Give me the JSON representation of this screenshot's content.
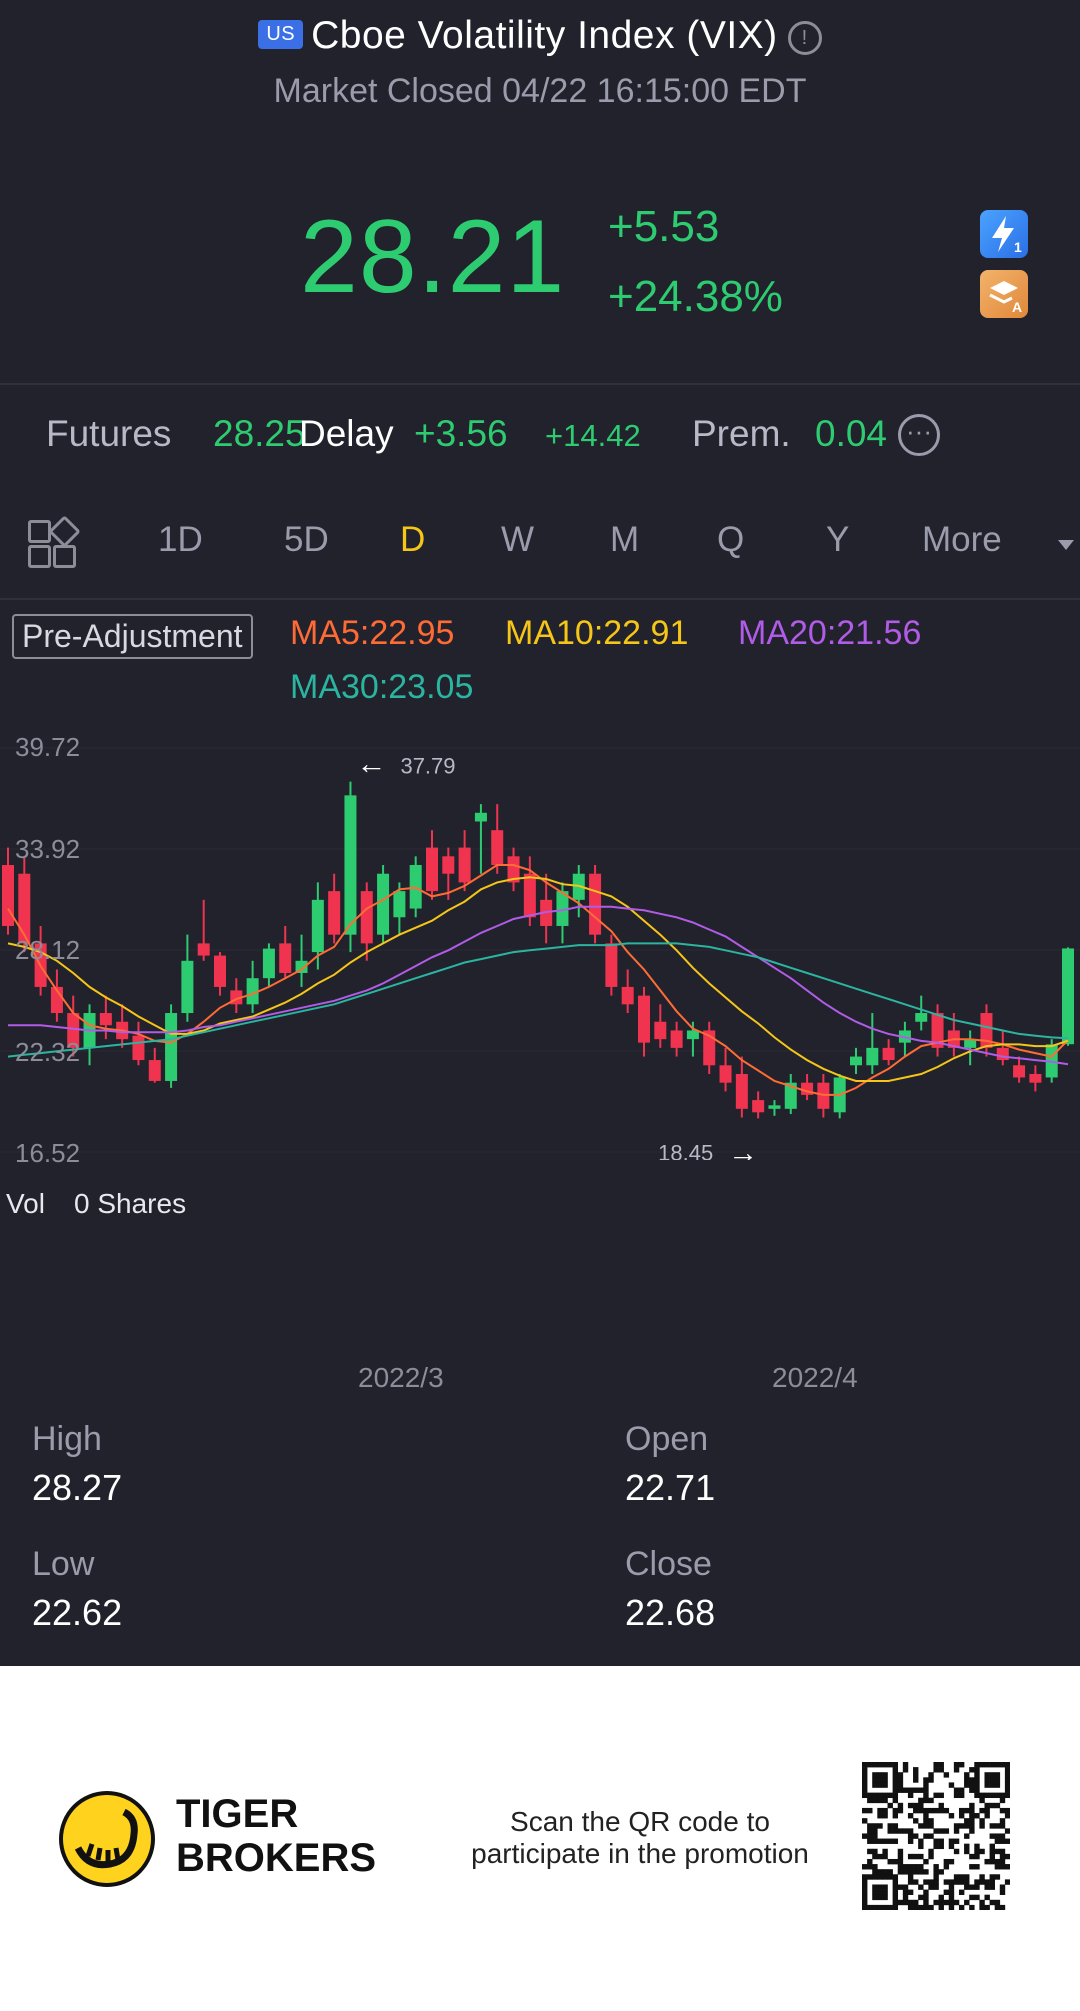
{
  "header": {
    "market_badge": "US",
    "title": "Cboe Volatility Index (VIX)",
    "status": "Market Closed 04/22 16:15:00 EDT"
  },
  "quote": {
    "price": "28.21",
    "change": "+5.53",
    "change_pct": "+24.38%",
    "side_icon_1": "lightning-icon",
    "side_icon_2": "stack-icon"
  },
  "futures": {
    "label": "Futures",
    "price": "28.25",
    "delay": "Delay",
    "change": "+3.56",
    "change2": "+14.42",
    "prem_label": "Prem.",
    "prem_value": "0.04"
  },
  "tabs": [
    "1D",
    "5D",
    "D",
    "W",
    "M",
    "Q",
    "Y",
    "More"
  ],
  "active_tab": "D",
  "indicators": {
    "adjustment": "Pre-Adjustment",
    "ma5": "MA5:22.95",
    "ma10": "MA10:22.91",
    "ma20": "MA20:21.56",
    "ma30": "MA30:23.05"
  },
  "chart_data": {
    "type": "candlestick",
    "y_ticks": [
      "39.72",
      "33.92",
      "28.12",
      "22.32",
      "16.52"
    ],
    "ylim": [
      16.52,
      39.72
    ],
    "x_ticks": [
      "2022/3",
      "2022/4"
    ],
    "high_marker": "37.79",
    "low_marker": "18.45",
    "candles": [
      {
        "o": 33.0,
        "h": 34.0,
        "l": 29.0,
        "c": 29.5
      },
      {
        "o": 32.5,
        "h": 33.5,
        "l": 28.0,
        "c": 28.5
      },
      {
        "o": 28.5,
        "h": 29.5,
        "l": 25.5,
        "c": 26.0
      },
      {
        "o": 26.0,
        "h": 27.0,
        "l": 24.0,
        "c": 24.5
      },
      {
        "o": 24.5,
        "h": 25.5,
        "l": 22.0,
        "c": 22.5
      },
      {
        "o": 22.5,
        "h": 25.0,
        "l": 21.5,
        "c": 24.5
      },
      {
        "o": 24.5,
        "h": 25.5,
        "l": 23.0,
        "c": 23.8
      },
      {
        "o": 24.0,
        "h": 25.0,
        "l": 22.5,
        "c": 23.0
      },
      {
        "o": 23.2,
        "h": 24.0,
        "l": 21.5,
        "c": 21.8
      },
      {
        "o": 21.8,
        "h": 22.5,
        "l": 20.5,
        "c": 20.6
      },
      {
        "o": 20.6,
        "h": 25.0,
        "l": 20.2,
        "c": 24.5
      },
      {
        "o": 24.5,
        "h": 29.0,
        "l": 24.0,
        "c": 27.5
      },
      {
        "o": 28.5,
        "h": 31.0,
        "l": 27.5,
        "c": 27.8
      },
      {
        "o": 27.8,
        "h": 28.0,
        "l": 25.5,
        "c": 26.0
      },
      {
        "o": 25.8,
        "h": 26.5,
        "l": 24.5,
        "c": 25.0
      },
      {
        "o": 25.0,
        "h": 27.5,
        "l": 24.5,
        "c": 26.5
      },
      {
        "o": 26.5,
        "h": 28.5,
        "l": 26.0,
        "c": 28.2
      },
      {
        "o": 28.5,
        "h": 29.5,
        "l": 26.5,
        "c": 26.8
      },
      {
        "o": 26.8,
        "h": 29.0,
        "l": 26.0,
        "c": 27.5
      },
      {
        "o": 28.0,
        "h": 32.0,
        "l": 27.0,
        "c": 31.0
      },
      {
        "o": 31.5,
        "h": 32.5,
        "l": 28.5,
        "c": 29.0
      },
      {
        "o": 29.0,
        "h": 37.79,
        "l": 28.0,
        "c": 37.0
      },
      {
        "o": 31.5,
        "h": 32.0,
        "l": 27.5,
        "c": 28.5
      },
      {
        "o": 29.0,
        "h": 33.0,
        "l": 28.5,
        "c": 32.5
      },
      {
        "o": 30.0,
        "h": 32.0,
        "l": 29.0,
        "c": 31.5
      },
      {
        "o": 30.5,
        "h": 33.5,
        "l": 30.0,
        "c": 33.0
      },
      {
        "o": 34.0,
        "h": 35.0,
        "l": 31.0,
        "c": 31.5
      },
      {
        "o": 33.5,
        "h": 34.0,
        "l": 31.0,
        "c": 32.5
      },
      {
        "o": 34.0,
        "h": 35.0,
        "l": 31.5,
        "c": 32.0
      },
      {
        "o": 35.5,
        "h": 36.5,
        "l": 32.5,
        "c": 36.0
      },
      {
        "o": 35.0,
        "h": 36.5,
        "l": 32.5,
        "c": 33.0
      },
      {
        "o": 33.5,
        "h": 34.0,
        "l": 31.5,
        "c": 32.0
      },
      {
        "o": 32.5,
        "h": 33.5,
        "l": 29.5,
        "c": 30.0
      },
      {
        "o": 31.0,
        "h": 32.5,
        "l": 28.5,
        "c": 29.5
      },
      {
        "o": 29.5,
        "h": 32.0,
        "l": 28.5,
        "c": 31.5
      },
      {
        "o": 31.0,
        "h": 33.0,
        "l": 30.0,
        "c": 32.5
      },
      {
        "o": 32.5,
        "h": 33.0,
        "l": 28.5,
        "c": 29.0
      },
      {
        "o": 28.5,
        "h": 29.0,
        "l": 25.5,
        "c": 26.0
      },
      {
        "o": 26.0,
        "h": 27.0,
        "l": 24.5,
        "c": 25.0
      },
      {
        "o": 25.5,
        "h": 26.0,
        "l": 22.0,
        "c": 22.8
      },
      {
        "o": 24.0,
        "h": 25.0,
        "l": 22.5,
        "c": 23.0
      },
      {
        "o": 23.5,
        "h": 24.0,
        "l": 22.0,
        "c": 22.5
      },
      {
        "o": 23.0,
        "h": 24.0,
        "l": 22.0,
        "c": 23.5
      },
      {
        "o": 23.5,
        "h": 24.0,
        "l": 21.0,
        "c": 21.5
      },
      {
        "o": 21.5,
        "h": 22.5,
        "l": 20.0,
        "c": 20.5
      },
      {
        "o": 21.0,
        "h": 22.0,
        "l": 18.5,
        "c": 19.0
      },
      {
        "o": 19.5,
        "h": 20.0,
        "l": 18.45,
        "c": 18.8
      },
      {
        "o": 19.0,
        "h": 19.5,
        "l": 18.6,
        "c": 19.2
      },
      {
        "o": 19.0,
        "h": 21.0,
        "l": 18.7,
        "c": 20.5
      },
      {
        "o": 20.5,
        "h": 21.0,
        "l": 19.5,
        "c": 19.8
      },
      {
        "o": 20.5,
        "h": 21.0,
        "l": 18.5,
        "c": 19.0
      },
      {
        "o": 18.8,
        "h": 21.0,
        "l": 18.45,
        "c": 20.8
      },
      {
        "o": 21.5,
        "h": 22.5,
        "l": 21.0,
        "c": 22.0
      },
      {
        "o": 21.5,
        "h": 24.5,
        "l": 21.0,
        "c": 22.5
      },
      {
        "o": 22.5,
        "h": 23.0,
        "l": 21.5,
        "c": 21.8
      },
      {
        "o": 22.8,
        "h": 24.0,
        "l": 22.0,
        "c": 23.5
      },
      {
        "o": 24.0,
        "h": 25.5,
        "l": 23.5,
        "c": 24.5
      },
      {
        "o": 24.5,
        "h": 25.0,
        "l": 22.0,
        "c": 22.5
      },
      {
        "o": 23.5,
        "h": 24.5,
        "l": 22.0,
        "c": 22.5
      },
      {
        "o": 22.5,
        "h": 23.5,
        "l": 21.5,
        "c": 23.0
      },
      {
        "o": 24.5,
        "h": 25.0,
        "l": 22.0,
        "c": 22.5
      },
      {
        "o": 22.5,
        "h": 23.5,
        "l": 21.5,
        "c": 21.8
      },
      {
        "o": 21.5,
        "h": 22.0,
        "l": 20.5,
        "c": 20.8
      },
      {
        "o": 21.0,
        "h": 21.5,
        "l": 20.0,
        "c": 20.5
      },
      {
        "o": 20.8,
        "h": 23.0,
        "l": 20.5,
        "c": 22.7
      },
      {
        "o": 22.71,
        "h": 28.27,
        "l": 22.62,
        "c": 28.21
      }
    ],
    "series": [
      {
        "name": "MA5",
        "color": "#ff6b35",
        "values": [
          30.5,
          29.0,
          27.2,
          25.8,
          24.5,
          23.8,
          23.6,
          23.5,
          23.3,
          22.9,
          22.8,
          23.3,
          24.0,
          24.8,
          25.3,
          25.6,
          26.0,
          26.5,
          27.0,
          27.8,
          28.3,
          29.6,
          30.5,
          31.0,
          31.6,
          31.7,
          31.2,
          31.4,
          31.8,
          32.4,
          33.0,
          33.0,
          32.7,
          32.0,
          31.4,
          30.8,
          30.0,
          29.2,
          28.0,
          27.0,
          25.8,
          24.6,
          23.6,
          23.2,
          22.6,
          21.8,
          21.2,
          20.6,
          20.3,
          20.0,
          19.8,
          19.8,
          20.2,
          20.8,
          21.3,
          22.0,
          22.6,
          22.8,
          23.0,
          23.0,
          22.9,
          22.7,
          22.4,
          22.2,
          22.0,
          22.95
        ]
      },
      {
        "name": "MA10",
        "color": "#f5c518",
        "values": [
          28.5,
          28.3,
          28.0,
          27.5,
          26.8,
          26.0,
          25.4,
          24.9,
          24.3,
          23.8,
          23.3,
          23.3,
          23.5,
          23.9,
          24.1,
          24.3,
          24.7,
          25.1,
          25.6,
          26.2,
          26.7,
          27.4,
          28.0,
          28.5,
          29.0,
          29.4,
          29.8,
          30.4,
          30.9,
          31.6,
          32.0,
          32.2,
          32.3,
          32.2,
          31.9,
          31.8,
          31.5,
          31.2,
          30.6,
          29.8,
          29.0,
          28.1,
          27.1,
          26.2,
          25.4,
          24.6,
          23.9,
          23.1,
          22.4,
          21.8,
          21.3,
          20.9,
          20.6,
          20.6,
          20.6,
          20.8,
          21.0,
          21.4,
          21.9,
          22.3,
          22.6,
          22.7,
          22.7,
          22.6,
          22.6,
          22.91
        ]
      },
      {
        "name": "MA20",
        "color": "#b05ce6",
        "values": [
          23.8,
          23.8,
          23.8,
          23.7,
          23.6,
          23.5,
          23.5,
          23.4,
          23.4,
          23.4,
          23.4,
          23.5,
          23.7,
          23.8,
          24.0,
          24.2,
          24.4,
          24.6,
          24.8,
          25.0,
          25.2,
          25.5,
          25.8,
          26.2,
          26.7,
          27.2,
          27.7,
          28.1,
          28.6,
          29.1,
          29.5,
          29.9,
          30.1,
          30.3,
          30.4,
          30.6,
          30.6,
          30.6,
          30.5,
          30.4,
          30.2,
          30.0,
          29.7,
          29.3,
          28.9,
          28.3,
          27.7,
          27.1,
          26.5,
          25.8,
          25.1,
          24.5,
          24.0,
          23.6,
          23.3,
          23.1,
          22.9,
          22.8,
          22.6,
          22.4,
          22.2,
          22.0,
          21.9,
          21.8,
          21.7,
          21.56
        ]
      },
      {
        "name": "MA30",
        "color": "#2bb5a0",
        "values": [
          22.0,
          22.1,
          22.2,
          22.3,
          22.4,
          22.5,
          22.6,
          22.7,
          22.8,
          22.9,
          23.0,
          23.2,
          23.4,
          23.6,
          23.8,
          24.0,
          24.2,
          24.4,
          24.6,
          24.8,
          25.0,
          25.3,
          25.6,
          25.9,
          26.2,
          26.5,
          26.8,
          27.1,
          27.4,
          27.6,
          27.8,
          28.0,
          28.1,
          28.2,
          28.3,
          28.4,
          28.4,
          28.4,
          28.5,
          28.5,
          28.5,
          28.5,
          28.4,
          28.3,
          28.1,
          27.9,
          27.7,
          27.4,
          27.1,
          26.8,
          26.5,
          26.2,
          25.9,
          25.6,
          25.3,
          25.0,
          24.7,
          24.4,
          24.1,
          23.9,
          23.7,
          23.5,
          23.3,
          23.2,
          23.1,
          23.05
        ]
      }
    ]
  },
  "volume": {
    "label": "Vol",
    "value": "0 Shares"
  },
  "stats": {
    "high_label": "High",
    "high": "28.27",
    "open_label": "Open",
    "open": "22.71",
    "low_label": "Low",
    "low": "22.62",
    "close_label": "Close",
    "close": "22.68"
  },
  "footer": {
    "brand_line1": "TIGER",
    "brand_line2": "BROKERS",
    "promo_line1": "Scan the QR code to",
    "promo_line2": "participate in the promotion"
  },
  "colors": {
    "up": "#2ecc71",
    "down": "#f0344f",
    "accent": "#f5c518",
    "background": "#21222c"
  }
}
